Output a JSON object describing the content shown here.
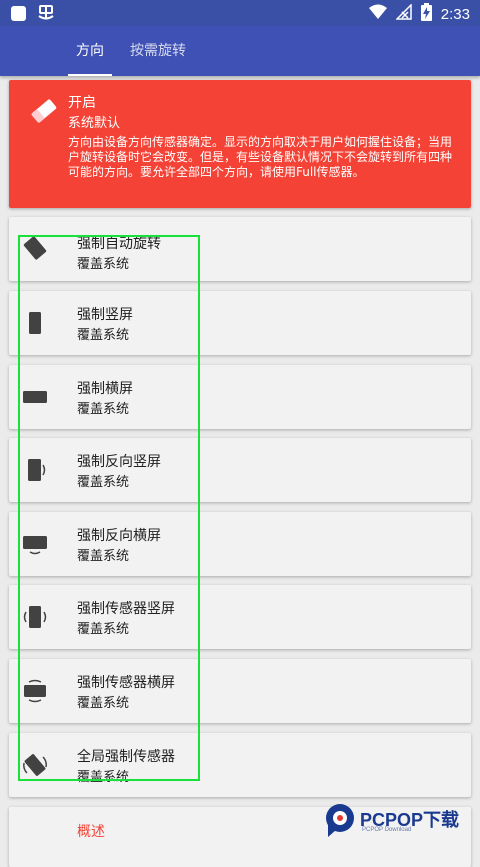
{
  "status_bar": {
    "time": "2:33"
  },
  "tabs": [
    {
      "label": "方向",
      "active": true
    },
    {
      "label": "按需旋转",
      "active": false
    }
  ],
  "header_card": {
    "title": "开启",
    "subtitle": "系统默认",
    "description": "方向由设备方向传感器确定。显示的方向取决于用户如何握住设备；当用户旋转设备时它会改变。但是，有些设备默认情况下不会旋转到所有四种可能的方向。要允许全部四个方向，请使用Full传感器。"
  },
  "items": [
    {
      "title": "强制自动旋转",
      "subtitle": "覆盖系统",
      "icon": "auto-rotate-icon"
    },
    {
      "title": "强制竖屏",
      "subtitle": "覆盖系统",
      "icon": "portrait-icon"
    },
    {
      "title": "强制横屏",
      "subtitle": "覆盖系统",
      "icon": "landscape-icon"
    },
    {
      "title": "强制反向竖屏",
      "subtitle": "覆盖系统",
      "icon": "reverse-portrait-icon"
    },
    {
      "title": "强制反向横屏",
      "subtitle": "覆盖系统",
      "icon": "reverse-landscape-icon"
    },
    {
      "title": "强制传感器竖屏",
      "subtitle": "覆盖系统",
      "icon": "sensor-portrait-icon"
    },
    {
      "title": "强制传感器横屏",
      "subtitle": "覆盖系统",
      "icon": "sensor-landscape-icon"
    },
    {
      "title": "全局强制传感器",
      "subtitle": "覆盖系统",
      "icon": "full-sensor-icon"
    }
  ],
  "overview": {
    "label": "概述"
  },
  "watermark": {
    "brand": "PCPOP下载",
    "small": "PCPOP Download"
  },
  "colors": {
    "status_bar": "#3a50a6",
    "app_bar": "#3f51b5",
    "accent_red": "#f44336",
    "highlight_green": "#18e23a"
  }
}
